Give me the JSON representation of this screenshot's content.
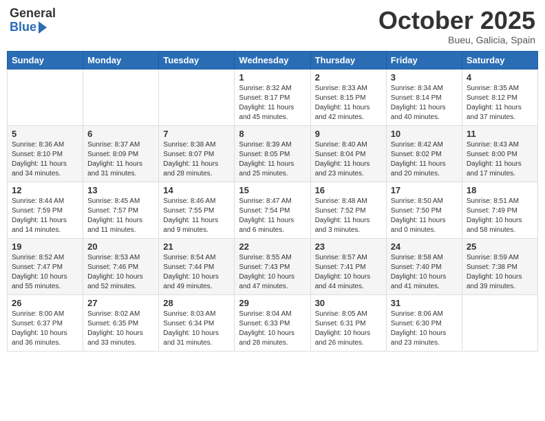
{
  "header": {
    "logo_general": "General",
    "logo_blue": "Blue",
    "month_title": "October 2025",
    "location": "Bueu, Galicia, Spain"
  },
  "days_of_week": [
    "Sunday",
    "Monday",
    "Tuesday",
    "Wednesday",
    "Thursday",
    "Friday",
    "Saturday"
  ],
  "weeks": [
    [
      {
        "day": "",
        "info": ""
      },
      {
        "day": "",
        "info": ""
      },
      {
        "day": "",
        "info": ""
      },
      {
        "day": "1",
        "info": "Sunrise: 8:32 AM\nSunset: 8:17 PM\nDaylight: 11 hours and 45 minutes."
      },
      {
        "day": "2",
        "info": "Sunrise: 8:33 AM\nSunset: 8:15 PM\nDaylight: 11 hours and 42 minutes."
      },
      {
        "day": "3",
        "info": "Sunrise: 8:34 AM\nSunset: 8:14 PM\nDaylight: 11 hours and 40 minutes."
      },
      {
        "day": "4",
        "info": "Sunrise: 8:35 AM\nSunset: 8:12 PM\nDaylight: 11 hours and 37 minutes."
      }
    ],
    [
      {
        "day": "5",
        "info": "Sunrise: 8:36 AM\nSunset: 8:10 PM\nDaylight: 11 hours and 34 minutes."
      },
      {
        "day": "6",
        "info": "Sunrise: 8:37 AM\nSunset: 8:09 PM\nDaylight: 11 hours and 31 minutes."
      },
      {
        "day": "7",
        "info": "Sunrise: 8:38 AM\nSunset: 8:07 PM\nDaylight: 11 hours and 28 minutes."
      },
      {
        "day": "8",
        "info": "Sunrise: 8:39 AM\nSunset: 8:05 PM\nDaylight: 11 hours and 25 minutes."
      },
      {
        "day": "9",
        "info": "Sunrise: 8:40 AM\nSunset: 8:04 PM\nDaylight: 11 hours and 23 minutes."
      },
      {
        "day": "10",
        "info": "Sunrise: 8:42 AM\nSunset: 8:02 PM\nDaylight: 11 hours and 20 minutes."
      },
      {
        "day": "11",
        "info": "Sunrise: 8:43 AM\nSunset: 8:00 PM\nDaylight: 11 hours and 17 minutes."
      }
    ],
    [
      {
        "day": "12",
        "info": "Sunrise: 8:44 AM\nSunset: 7:59 PM\nDaylight: 11 hours and 14 minutes."
      },
      {
        "day": "13",
        "info": "Sunrise: 8:45 AM\nSunset: 7:57 PM\nDaylight: 11 hours and 11 minutes."
      },
      {
        "day": "14",
        "info": "Sunrise: 8:46 AM\nSunset: 7:55 PM\nDaylight: 11 hours and 9 minutes."
      },
      {
        "day": "15",
        "info": "Sunrise: 8:47 AM\nSunset: 7:54 PM\nDaylight: 11 hours and 6 minutes."
      },
      {
        "day": "16",
        "info": "Sunrise: 8:48 AM\nSunset: 7:52 PM\nDaylight: 11 hours and 3 minutes."
      },
      {
        "day": "17",
        "info": "Sunrise: 8:50 AM\nSunset: 7:50 PM\nDaylight: 11 hours and 0 minutes."
      },
      {
        "day": "18",
        "info": "Sunrise: 8:51 AM\nSunset: 7:49 PM\nDaylight: 10 hours and 58 minutes."
      }
    ],
    [
      {
        "day": "19",
        "info": "Sunrise: 8:52 AM\nSunset: 7:47 PM\nDaylight: 10 hours and 55 minutes."
      },
      {
        "day": "20",
        "info": "Sunrise: 8:53 AM\nSunset: 7:46 PM\nDaylight: 10 hours and 52 minutes."
      },
      {
        "day": "21",
        "info": "Sunrise: 8:54 AM\nSunset: 7:44 PM\nDaylight: 10 hours and 49 minutes."
      },
      {
        "day": "22",
        "info": "Sunrise: 8:55 AM\nSunset: 7:43 PM\nDaylight: 10 hours and 47 minutes."
      },
      {
        "day": "23",
        "info": "Sunrise: 8:57 AM\nSunset: 7:41 PM\nDaylight: 10 hours and 44 minutes."
      },
      {
        "day": "24",
        "info": "Sunrise: 8:58 AM\nSunset: 7:40 PM\nDaylight: 10 hours and 41 minutes."
      },
      {
        "day": "25",
        "info": "Sunrise: 8:59 AM\nSunset: 7:38 PM\nDaylight: 10 hours and 39 minutes."
      }
    ],
    [
      {
        "day": "26",
        "info": "Sunrise: 8:00 AM\nSunset: 6:37 PM\nDaylight: 10 hours and 36 minutes."
      },
      {
        "day": "27",
        "info": "Sunrise: 8:02 AM\nSunset: 6:35 PM\nDaylight: 10 hours and 33 minutes."
      },
      {
        "day": "28",
        "info": "Sunrise: 8:03 AM\nSunset: 6:34 PM\nDaylight: 10 hours and 31 minutes."
      },
      {
        "day": "29",
        "info": "Sunrise: 8:04 AM\nSunset: 6:33 PM\nDaylight: 10 hours and 28 minutes."
      },
      {
        "day": "30",
        "info": "Sunrise: 8:05 AM\nSunset: 6:31 PM\nDaylight: 10 hours and 26 minutes."
      },
      {
        "day": "31",
        "info": "Sunrise: 8:06 AM\nSunset: 6:30 PM\nDaylight: 10 hours and 23 minutes."
      },
      {
        "day": "",
        "info": ""
      }
    ]
  ]
}
